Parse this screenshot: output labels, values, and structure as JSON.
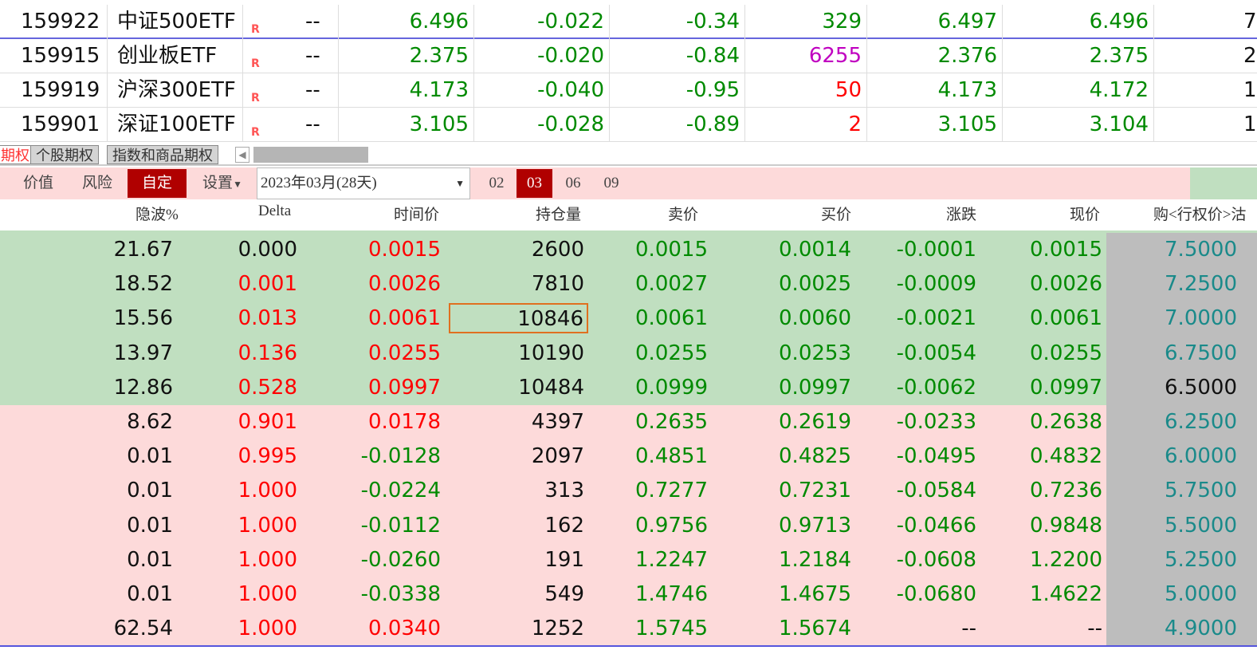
{
  "etf_rows": [
    {
      "code": "159922",
      "name": "中证500ETF",
      "flag": "R",
      "dash": "--",
      "price": "6.496",
      "change": "-0.022",
      "pct": "-0.34",
      "vol": "329",
      "vol_color": "green",
      "sell": "6.497",
      "buy": "6.496",
      "partial": "7"
    },
    {
      "code": "159915",
      "name": "创业板ETF",
      "flag": "R",
      "dash": "--",
      "price": "2.375",
      "change": "-0.020",
      "pct": "-0.84",
      "vol": "6255",
      "vol_color": "magenta",
      "sell": "2.376",
      "buy": "2.375",
      "partial": "2"
    },
    {
      "code": "159919",
      "name": "沪深300ETF",
      "flag": "R",
      "dash": "--",
      "price": "4.173",
      "change": "-0.040",
      "pct": "-0.95",
      "vol": "50",
      "vol_color": "red",
      "sell": "4.173",
      "buy": "4.172",
      "partial": "1"
    },
    {
      "code": "159901",
      "name": "深证100ETF",
      "flag": "R",
      "dash": "--",
      "price": "3.105",
      "change": "-0.028",
      "pct": "-0.89",
      "vol": "2",
      "vol_color": "red",
      "sell": "3.105",
      "buy": "3.104",
      "partial": "1"
    }
  ],
  "sheet_tabs": [
    "期权",
    "个股期权",
    "指数和商品期权"
  ],
  "toolbar": {
    "value": "价值",
    "risk": "风险",
    "custom": "自定",
    "settings": "设置",
    "expiry": "2023年03月(28天)",
    "months": [
      "02",
      "03",
      "06",
      "09"
    ],
    "active_month": "03"
  },
  "headers": [
    "隐波%",
    "Delta",
    "时间价",
    "持仓量",
    "卖价",
    "买价",
    "涨跌",
    "现价",
    "购<行权价>沽"
  ],
  "colors": {
    "itm_bg": "#c0dfc0",
    "otm_bg": "#fddada",
    "strike_bg": "#bdbdbd",
    "accent": "#b00000"
  },
  "options": [
    {
      "iv": "21.67",
      "delta": "0.000",
      "tv": "0.0015",
      "oi": "2600",
      "ask": "0.0015",
      "bid": "0.0014",
      "chg": "-0.0001",
      "last": "0.0015",
      "strike": "7.5000"
    },
    {
      "iv": "18.52",
      "delta": "0.001",
      "tv": "0.0026",
      "oi": "7810",
      "ask": "0.0027",
      "bid": "0.0025",
      "chg": "-0.0009",
      "last": "0.0026",
      "strike": "7.2500"
    },
    {
      "iv": "15.56",
      "delta": "0.013",
      "tv": "0.0061",
      "oi": "10846",
      "ask": "0.0061",
      "bid": "0.0060",
      "chg": "-0.0021",
      "last": "0.0061",
      "strike": "7.0000",
      "selected": true
    },
    {
      "iv": "13.97",
      "delta": "0.136",
      "tv": "0.0255",
      "oi": "10190",
      "ask": "0.0255",
      "bid": "0.0253",
      "chg": "-0.0054",
      "last": "0.0255",
      "strike": "6.7500"
    },
    {
      "iv": "12.86",
      "delta": "0.528",
      "tv": "0.0997",
      "oi": "10484",
      "ask": "0.0999",
      "bid": "0.0997",
      "chg": "-0.0062",
      "last": "0.0997",
      "strike": "6.5000"
    },
    {
      "iv": "8.62",
      "delta": "0.901",
      "tv": "0.0178",
      "oi": "4397",
      "ask": "0.2635",
      "bid": "0.2619",
      "chg": "-0.0233",
      "last": "0.2638",
      "strike": "6.2500"
    },
    {
      "iv": "0.01",
      "delta": "0.995",
      "tv": "-0.0128",
      "oi": "2097",
      "ask": "0.4851",
      "bid": "0.4825",
      "chg": "-0.0495",
      "last": "0.4832",
      "strike": "6.0000"
    },
    {
      "iv": "0.01",
      "delta": "1.000",
      "tv": "-0.0224",
      "oi": "313",
      "ask": "0.7277",
      "bid": "0.7231",
      "chg": "-0.0584",
      "last": "0.7236",
      "strike": "5.7500"
    },
    {
      "iv": "0.01",
      "delta": "1.000",
      "tv": "-0.0112",
      "oi": "162",
      "ask": "0.9756",
      "bid": "0.9713",
      "chg": "-0.0466",
      "last": "0.9848",
      "strike": "5.5000"
    },
    {
      "iv": "0.01",
      "delta": "1.000",
      "tv": "-0.0260",
      "oi": "191",
      "ask": "1.2247",
      "bid": "1.2184",
      "chg": "-0.0608",
      "last": "1.2200",
      "strike": "5.2500"
    },
    {
      "iv": "0.01",
      "delta": "1.000",
      "tv": "-0.0338",
      "oi": "549",
      "ask": "1.4746",
      "bid": "1.4675",
      "chg": "-0.0680",
      "last": "1.4622",
      "strike": "5.0000"
    },
    {
      "iv": "62.54",
      "delta": "1.000",
      "tv": "0.0340",
      "oi": "1252",
      "ask": "1.5745",
      "bid": "1.5674",
      "chg": "--",
      "last": "--",
      "strike": "4.9000"
    }
  ]
}
